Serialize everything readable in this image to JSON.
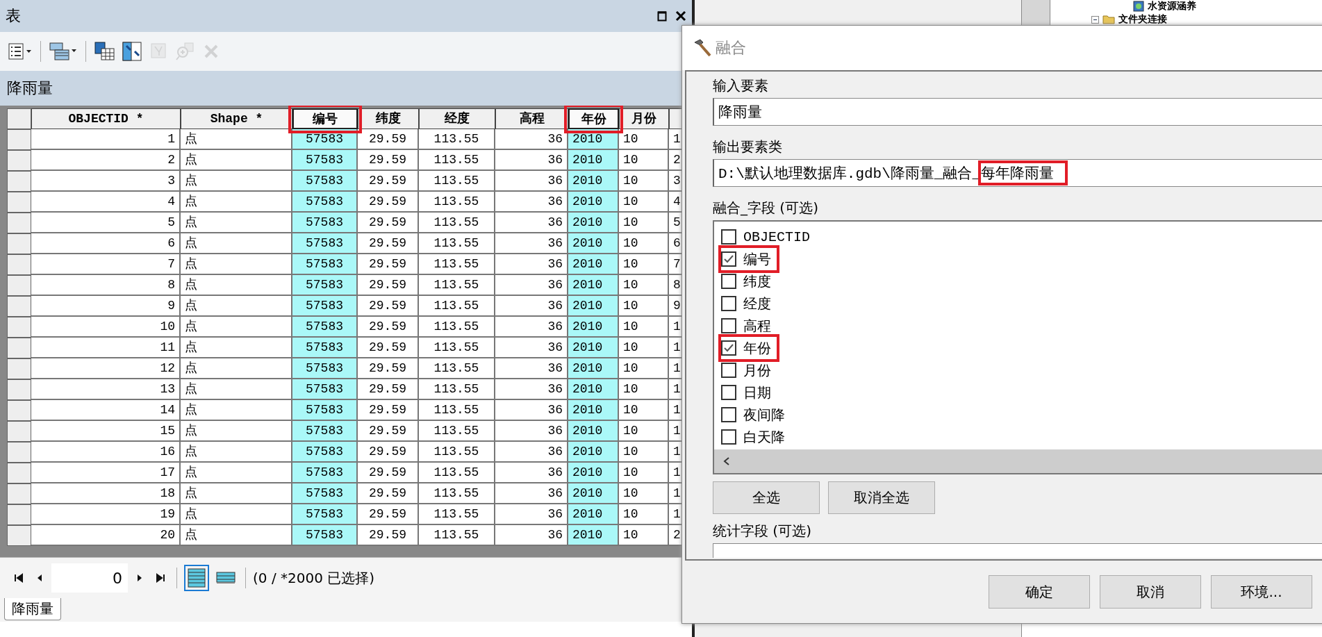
{
  "background_tree": {
    "items": [
      {
        "label": "水资源涵养",
        "kind": "map"
      },
      {
        "label": "文件夹连接",
        "kind": "folder"
      }
    ]
  },
  "table_window": {
    "title": "表",
    "toolbar": [
      {
        "kind": "table-options",
        "disabled": false
      },
      {
        "kind": "related-tables",
        "disabled": false
      },
      {
        "kind": "select-by-attributes",
        "disabled": false
      },
      {
        "kind": "switch-selection",
        "disabled": false
      },
      {
        "kind": "clear-selection",
        "disabled": true
      },
      {
        "kind": "zoom-to-selected",
        "disabled": true
      },
      {
        "kind": "delete-selected",
        "disabled": true
      }
    ],
    "table_name": "降雨量",
    "columns": [
      {
        "label": "OBJECTID *",
        "selected": false,
        "highlighted": false
      },
      {
        "label": "Shape *",
        "selected": false,
        "highlighted": false
      },
      {
        "label": "编号",
        "selected": true,
        "highlighted": true
      },
      {
        "label": "纬度",
        "selected": false,
        "highlighted": false
      },
      {
        "label": "经度",
        "selected": false,
        "highlighted": false
      },
      {
        "label": "高程",
        "selected": false,
        "highlighted": false
      },
      {
        "label": "年份",
        "selected": true,
        "highlighted": true
      },
      {
        "label": "月份",
        "selected": false,
        "highlighted": false
      },
      {
        "selected": false,
        "highlighted": false
      }
    ],
    "rows": [
      {
        "cells": [
          "1",
          "点",
          "57583",
          "29.59",
          "113.55",
          "36",
          "2010",
          "10",
          "1"
        ]
      },
      {
        "cells": [
          "2",
          "点",
          "57583",
          "29.59",
          "113.55",
          "36",
          "2010",
          "10",
          "2"
        ]
      },
      {
        "cells": [
          "3",
          "点",
          "57583",
          "29.59",
          "113.55",
          "36",
          "2010",
          "10",
          "3"
        ]
      },
      {
        "cells": [
          "4",
          "点",
          "57583",
          "29.59",
          "113.55",
          "36",
          "2010",
          "10",
          "4"
        ]
      },
      {
        "cells": [
          "5",
          "点",
          "57583",
          "29.59",
          "113.55",
          "36",
          "2010",
          "10",
          "5"
        ]
      },
      {
        "cells": [
          "6",
          "点",
          "57583",
          "29.59",
          "113.55",
          "36",
          "2010",
          "10",
          "6"
        ]
      },
      {
        "cells": [
          "7",
          "点",
          "57583",
          "29.59",
          "113.55",
          "36",
          "2010",
          "10",
          "7"
        ]
      },
      {
        "cells": [
          "8",
          "点",
          "57583",
          "29.59",
          "113.55",
          "36",
          "2010",
          "10",
          "8"
        ]
      },
      {
        "cells": [
          "9",
          "点",
          "57583",
          "29.59",
          "113.55",
          "36",
          "2010",
          "10",
          "9"
        ]
      },
      {
        "cells": [
          "10",
          "点",
          "57583",
          "29.59",
          "113.55",
          "36",
          "2010",
          "10",
          "1"
        ]
      },
      {
        "cells": [
          "11",
          "点",
          "57583",
          "29.59",
          "113.55",
          "36",
          "2010",
          "10",
          "1"
        ]
      },
      {
        "cells": [
          "12",
          "点",
          "57583",
          "29.59",
          "113.55",
          "36",
          "2010",
          "10",
          "1"
        ]
      },
      {
        "cells": [
          "13",
          "点",
          "57583",
          "29.59",
          "113.55",
          "36",
          "2010",
          "10",
          "1"
        ]
      },
      {
        "cells": [
          "14",
          "点",
          "57583",
          "29.59",
          "113.55",
          "36",
          "2010",
          "10",
          "1"
        ]
      },
      {
        "cells": [
          "15",
          "点",
          "57583",
          "29.59",
          "113.55",
          "36",
          "2010",
          "10",
          "1"
        ]
      },
      {
        "cells": [
          "16",
          "点",
          "57583",
          "29.59",
          "113.55",
          "36",
          "2010",
          "10",
          "1"
        ]
      },
      {
        "cells": [
          "17",
          "点",
          "57583",
          "29.59",
          "113.55",
          "36",
          "2010",
          "10",
          "1"
        ]
      },
      {
        "cells": [
          "18",
          "点",
          "57583",
          "29.59",
          "113.55",
          "36",
          "2010",
          "10",
          "1"
        ]
      },
      {
        "cells": [
          "19",
          "点",
          "57583",
          "29.59",
          "113.55",
          "36",
          "2010",
          "10",
          "1"
        ]
      },
      {
        "cells": [
          "20",
          "点",
          "57583",
          "29.59",
          "113.55",
          "36",
          "2010",
          "10",
          "2"
        ]
      }
    ],
    "navigator": {
      "record": "0",
      "views": [
        {
          "kind": "all-records",
          "selected": true
        },
        {
          "kind": "selected-records",
          "selected": false
        }
      ],
      "status": "(0 / *2000 已选择)"
    },
    "tabs": [
      {
        "label": "降雨量",
        "selected": true
      }
    ]
  },
  "dialog": {
    "title": "融合",
    "input_label": "输入要素",
    "input_value": "降雨量",
    "output_label": "输出要素类",
    "output_parts": [
      {
        "text": "D:\\默认地理数据库.gdb\\降雨量_融合_",
        "highlighted": false
      },
      {
        "text": "每年降雨量",
        "highlighted": true
      }
    ],
    "fields_label": "融合_字段 (可选)",
    "fields": [
      {
        "label": "OBJECTID",
        "checked": false,
        "highlighted": false
      },
      {
        "label": "编号",
        "checked": true,
        "highlighted": true
      },
      {
        "label": "纬度",
        "checked": false,
        "highlighted": false
      },
      {
        "label": "经度",
        "checked": false,
        "highlighted": false
      },
      {
        "label": "高程",
        "checked": false,
        "highlighted": false
      },
      {
        "label": "年份",
        "checked": true,
        "highlighted": true
      },
      {
        "label": "月份",
        "checked": false,
        "highlighted": false
      },
      {
        "label": "日期",
        "checked": false,
        "highlighted": false
      },
      {
        "label": "夜间降",
        "checked": false,
        "highlighted": false
      },
      {
        "label": "白天降",
        "checked": false,
        "highlighted": false
      }
    ],
    "list_buttons": [
      "全选",
      "取消全选"
    ],
    "statistics_label": "统计字段 (可选)",
    "buttons": [
      "确定",
      "取消",
      "环境..."
    ]
  }
}
